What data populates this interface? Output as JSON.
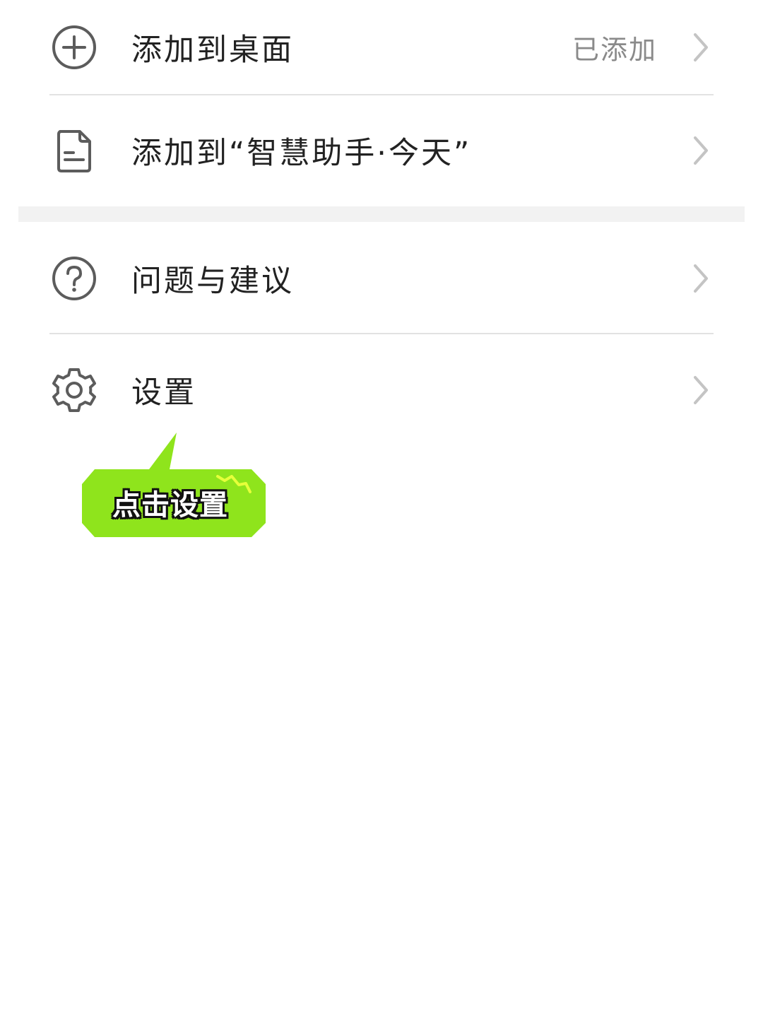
{
  "menu": {
    "add_desktop": {
      "label": "添加到桌面",
      "status": "已添加",
      "icon": "plus-circle-icon"
    },
    "add_assistant": {
      "label": "添加到“智慧助手·今天”",
      "icon": "document-icon"
    },
    "feedback": {
      "label": "问题与建议",
      "icon": "question-circle-icon"
    },
    "settings": {
      "label": "设置",
      "icon": "gear-icon"
    }
  },
  "callout": {
    "text": "点击设置",
    "color": "#8fe41c"
  },
  "colors": {
    "icon": "#5c5c5c",
    "chevron": "#c4c4c4",
    "divider": "#e2e2e2",
    "section_gap": "#f2f2f2"
  }
}
